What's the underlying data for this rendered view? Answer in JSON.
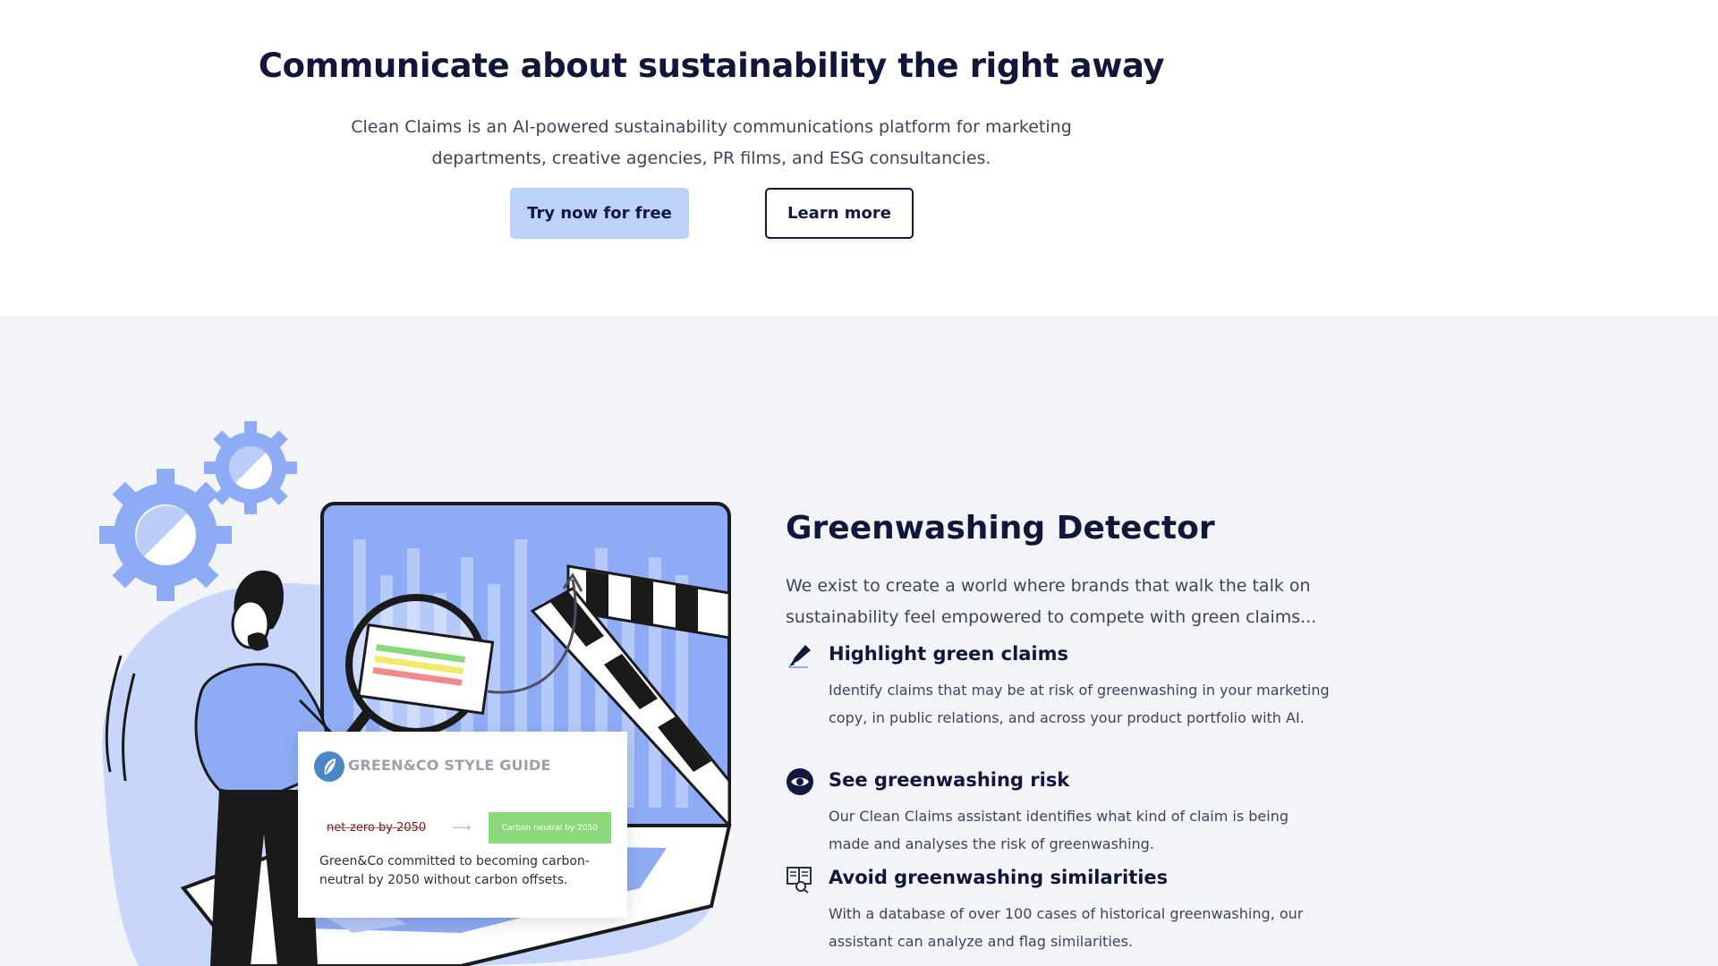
{
  "hero": {
    "title": "Communicate about sustainability the right away",
    "subtitle": "Clean Claims is an AI-powered sustainability communications platform for marketing departments, creative agencies, PR films, and ESG consultancies.",
    "primary_button": "Try now for free",
    "secondary_button": "Learn more"
  },
  "illustration": {
    "card_title": "GREEN&CO STYLE GUIDE",
    "strikethrough_claim": "net-zero by 2050",
    "replacement_tag": "Carbon neutral by 2050",
    "card_text": "Green&Co committed to becoming carbon-neutral by 2050 without carbon offsets."
  },
  "feature": {
    "title": "Greenwashing Detector",
    "intro": "We exist to create a world where brands that walk the talk on sustainability feel empowered to compete with green claims...",
    "items": [
      {
        "icon": "highlighter-icon",
        "title": "Highlight green claims",
        "description": "Identify claims that may be at risk of greenwashing in your marketing copy, in public relations, and across your product portfolio with AI."
      },
      {
        "icon": "eye-icon",
        "title": "See greenwashing risk",
        "description": "Our Clean Claims assistant identifies what kind of claim is being made and analyses the risk of greenwashing."
      },
      {
        "icon": "database-search-icon",
        "title": "Avoid greenwashing similarities",
        "description": "With a database of over 100 cases of historical greenwashing, our assistant can analyze and flag similarities."
      }
    ]
  },
  "colors": {
    "primary_button_bg": "#bcd3f7",
    "heading": "#11163b",
    "section_bg": "#f3f4f7",
    "illustration_blue": "#8eacf5",
    "tag_green": "#8ed87c"
  }
}
